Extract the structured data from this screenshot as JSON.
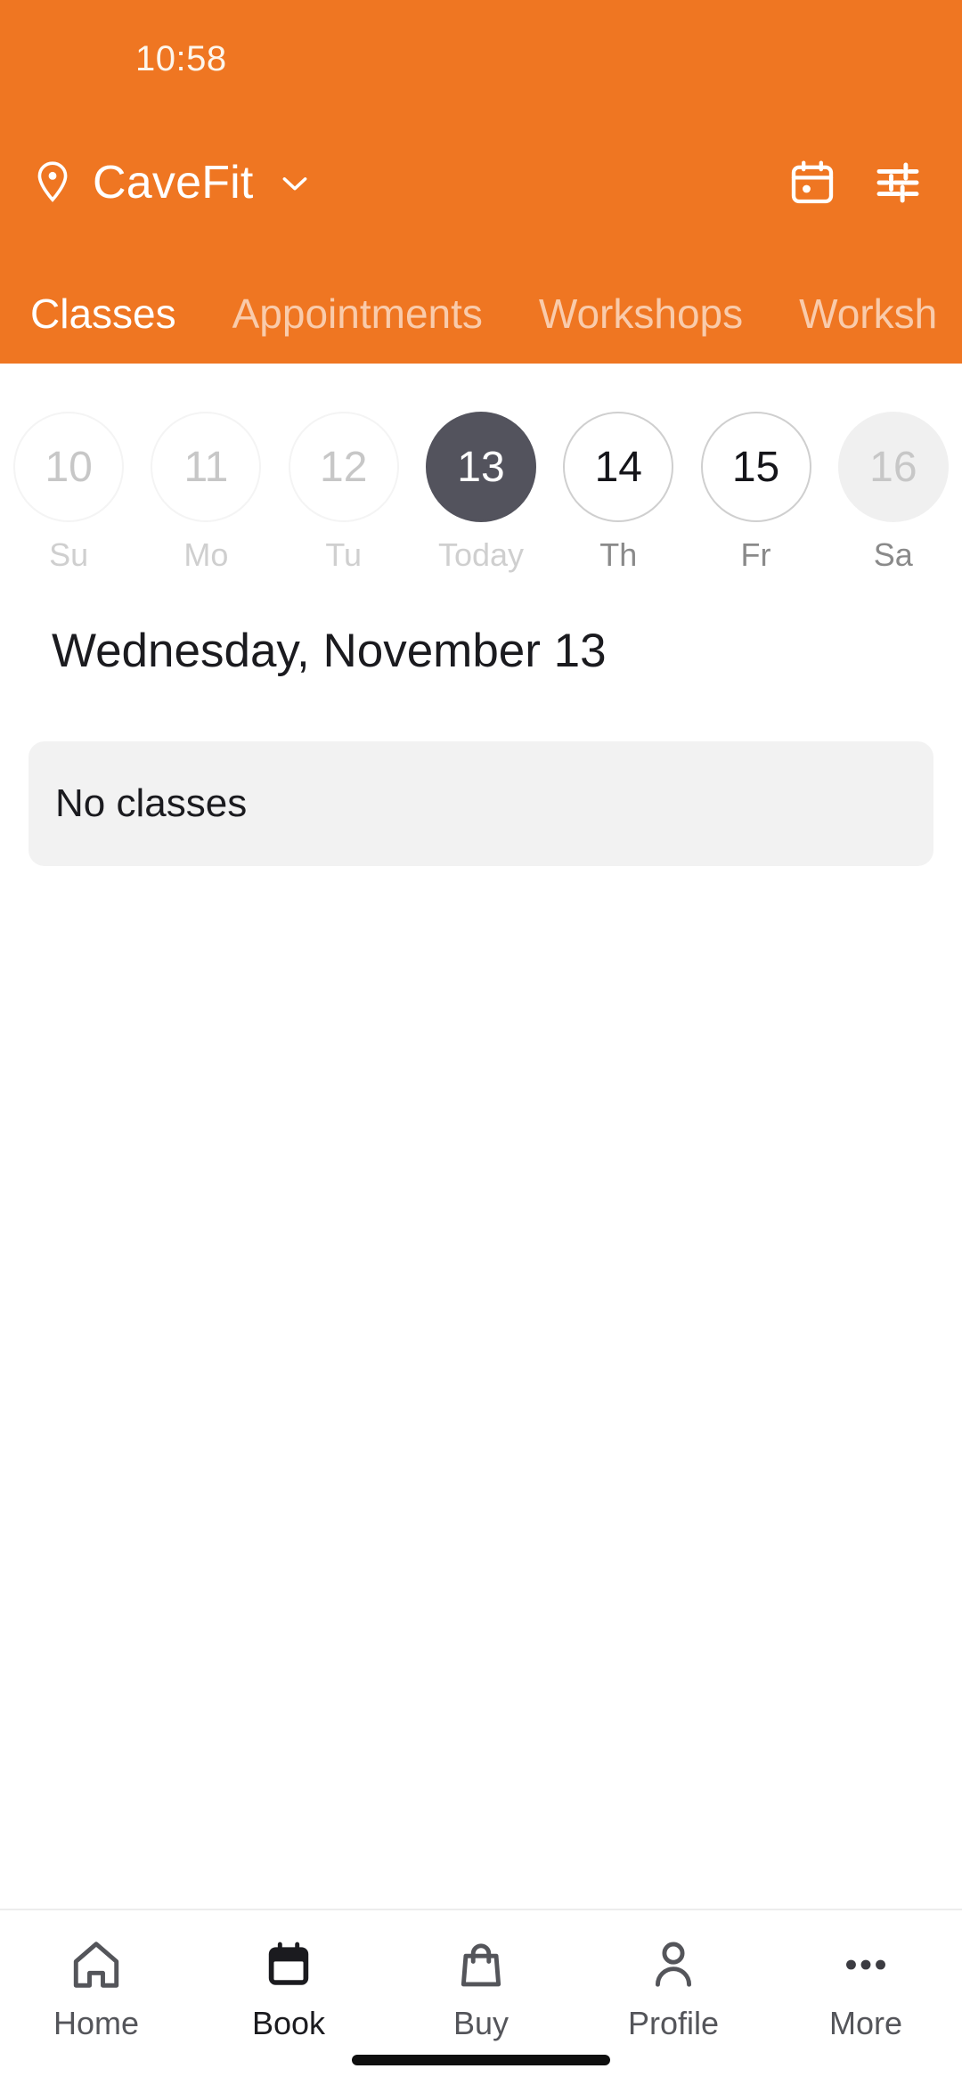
{
  "theme": {
    "brand_orange": "#ef7622",
    "selected_day_bg": "#53535d",
    "card_bg": "#f2f2f2",
    "text_dark": "#1b1b1f",
    "text_muted": "#9a9a9a"
  },
  "status_bar": {
    "time": "10:58"
  },
  "header": {
    "location_icon": "location-pin-icon",
    "location_name": "CaveFit",
    "location_chevron_icon": "chevron-down-icon",
    "actions": [
      {
        "icon": "calendar-icon",
        "name": "calendar-button"
      },
      {
        "icon": "sliders-filter-icon",
        "name": "filter-button"
      }
    ]
  },
  "tabs": [
    {
      "label": "Classes",
      "active": true
    },
    {
      "label": "Appointments",
      "active": false
    },
    {
      "label": "Workshops",
      "active": false
    },
    {
      "label": "Worksh",
      "active": false
    }
  ],
  "date_strip": [
    {
      "num": "10",
      "label": "Su",
      "state": "past"
    },
    {
      "num": "11",
      "label": "Mo",
      "state": "past"
    },
    {
      "num": "12",
      "label": "Tu",
      "state": "past"
    },
    {
      "num": "13",
      "label": "Today",
      "state": "selected"
    },
    {
      "num": "14",
      "label": "Th",
      "state": "future"
    },
    {
      "num": "15",
      "label": "Fr",
      "state": "future"
    },
    {
      "num": "16",
      "label": "Sa",
      "state": "disabled-fill"
    }
  ],
  "main": {
    "date_heading": "Wednesday, November 13",
    "empty_message": "No classes"
  },
  "bottom_nav": [
    {
      "label": "Home",
      "icon": "home-icon",
      "active": false
    },
    {
      "label": "Book",
      "icon": "calendar-filled-icon",
      "active": true
    },
    {
      "label": "Buy",
      "icon": "shopping-bag-icon",
      "active": false
    },
    {
      "label": "Profile",
      "icon": "person-icon",
      "active": false
    },
    {
      "label": "More",
      "icon": "ellipsis-icon",
      "active": false
    }
  ]
}
